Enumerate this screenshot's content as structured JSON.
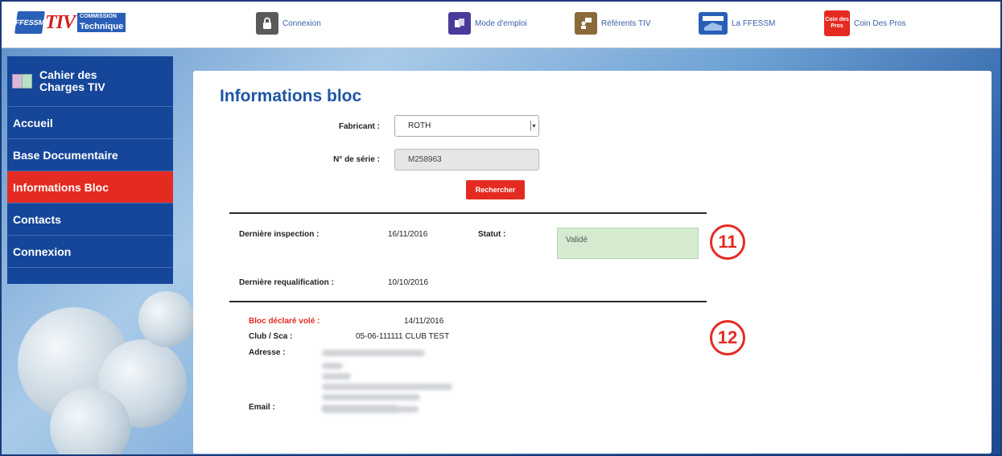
{
  "header": {
    "logo": {
      "badge": "FFESSM",
      "brand": "TIV",
      "line1": "COMMISSION",
      "line2": "Technique"
    },
    "nav": [
      {
        "label": "Connexion",
        "icon": "lock-icon",
        "color": "#5a5a5a"
      },
      {
        "label": "Mode d'emploi",
        "icon": "book-guide-icon",
        "color": "#4a3a9a"
      },
      {
        "label": "Référents TIV",
        "icon": "presenter-icon",
        "color": "#8a6a3a"
      },
      {
        "label": "La FFESSM",
        "icon": "ffessm-logo-icon",
        "color": "#2a5fb8"
      },
      {
        "label": "Coin Des Pros",
        "icon": "coin-des-pros-icon",
        "color": "#e32b22",
        "badge_text": "Coin des Pros"
      }
    ]
  },
  "sidebar": {
    "title_line1": "Cahier des",
    "title_line2": "Charges TIV",
    "items": [
      {
        "label": "Accueil",
        "active": false
      },
      {
        "label": "Base Documentaire",
        "active": false
      },
      {
        "label": "Informations Bloc",
        "active": true
      },
      {
        "label": "Contacts",
        "active": false
      },
      {
        "label": "Connexion",
        "active": false
      }
    ]
  },
  "main": {
    "title": "Informations bloc",
    "form": {
      "manufacturer_label": "Fabricant :",
      "manufacturer_value": "ROTH",
      "serial_label": "N° de série :",
      "serial_value": "M258963",
      "search_label": "Rechercher"
    },
    "inspection": {
      "last_inspection_label": "Dernière inspection :",
      "last_inspection_value": "16/11/2016",
      "status_label": "Statut :",
      "status_value": "Validé",
      "last_requalification_label": "Dernière requalification :",
      "last_requalification_value": "10/10/2016"
    },
    "theft": {
      "stolen_label": "Bloc déclaré volé :",
      "stolen_date": "14/11/2016",
      "club_label": "Club / Sca :",
      "club_value": "05-06-111111 CLUB TEST",
      "address_label": "Adresse :",
      "email_label": "Email :"
    },
    "callouts": [
      "11",
      "12"
    ]
  },
  "colors": {
    "brand_blue": "#15469a",
    "accent_red": "#e32b22",
    "title_blue": "#1f55a4",
    "status_green": "#d4ebd0"
  }
}
